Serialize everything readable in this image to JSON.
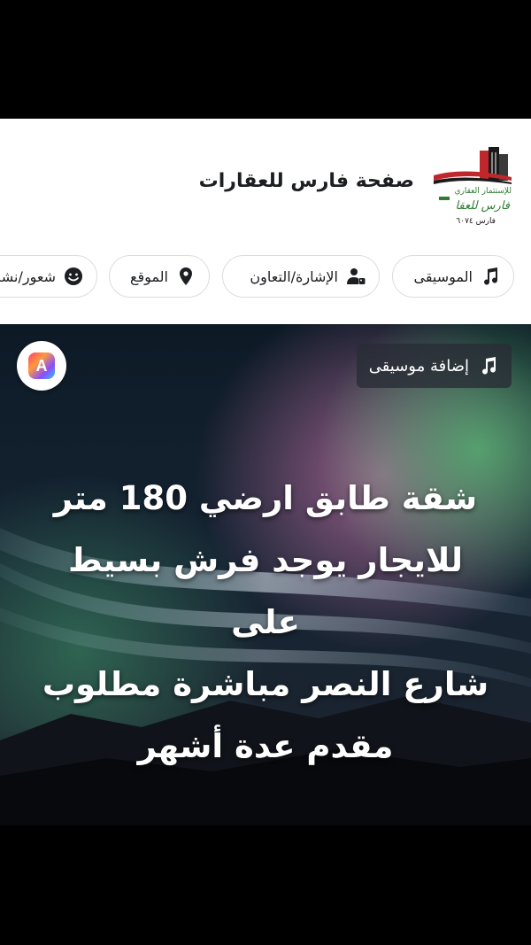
{
  "page": {
    "name": "صفحة فارس للعقارات"
  },
  "logo": {
    "line1": "للإستثمار العقاري",
    "line2": "فارس للعقا",
    "line3": "فارس ٦٠٧٤"
  },
  "chips": {
    "music": {
      "label": "الموسيقى",
      "icon": "music-note-icon"
    },
    "tag": {
      "label": "الإشارة/التعاون",
      "icon": "person-tag-icon"
    },
    "location": {
      "label": "الموقع",
      "icon": "location-pin-icon"
    },
    "feeling": {
      "label": "شعور/نشاط",
      "icon": "smiley-icon"
    }
  },
  "media": {
    "add_music_label": "إضافة موسيقى",
    "app_badge_letter": "A",
    "overlay_text": "شقة طابق ارضي 180  متر\nللايجار يوجد فرش بسيط على\nشارع النصر مباشرة مطلوب\nمقدم عدة أشهر"
  },
  "colors": {
    "header_bg": "#ffffff",
    "chip_border": "#dadde1",
    "text_primary": "#1c1e21",
    "logo_red": "#c0272d",
    "logo_green": "#2e7d32"
  }
}
